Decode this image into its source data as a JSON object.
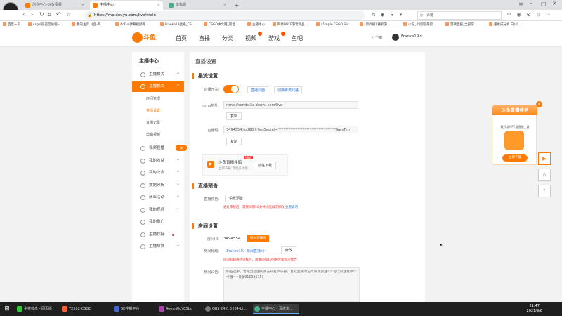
{
  "browser": {
    "tabs": [
      {
        "label": "创作中心-斗鱼视频",
        "active": false
      },
      {
        "label": "主播中心",
        "active": true
      },
      {
        "label": "无标题",
        "active": false
      }
    ],
    "new_tab": "+",
    "url": "https://mp.douyu.com/live/main",
    "search_placeholder": "百度",
    "bookmarks": [
      "百度一下",
      "csgo吧-百度贴吧--...",
      "我的主页 斗鱼-每...",
      "AcFun弹幕视频网...",
      "Franke19直播_CS...",
      "CSGO中文网_最佳...",
      "主播中心",
      "网易BUFF游戏饰品...",
      "s1mple CSGO Set...",
      "[新闻播] 赛机游...",
      "小说_小说网,最新...",
      "游戏直播_全部游...",
      "董希成分析 白(4)..."
    ]
  },
  "site": {
    "logo_text": "斗鱼",
    "nav": [
      "首页",
      "直播",
      "分类",
      "视频",
      "游戏",
      "鱼吧"
    ],
    "download": "下载",
    "username": "Franke19 ▾"
  },
  "sidebar": {
    "title": "主播中心",
    "items": [
      {
        "label": "主播相关",
        "arrow": "^"
      },
      {
        "label": "直播相关",
        "arrow": "^"
      },
      {
        "label": "视频投播",
        "arrow": "^"
      },
      {
        "label": "我的收益",
        "arrow": "^"
      },
      {
        "label": "我的公会",
        "arrow": "^"
      },
      {
        "label": "数据分析",
        "arrow": "^"
      },
      {
        "label": "商业活动",
        "arrow": "^"
      },
      {
        "label": "我的视频",
        "arrow": "^"
      },
      {
        "label": "我的推广",
        "arrow": ""
      },
      {
        "label": "主播扶持",
        "arrow": ""
      },
      {
        "label": "主播帮贷",
        "arrow": "^"
      }
    ],
    "subitems": [
      "房间管理",
      "直播设置",
      "直播记录",
      "剪辑视频"
    ],
    "hot_badge": "新"
  },
  "content": {
    "page_title": "直播设置",
    "stream": {
      "heading": "推流设置",
      "switch_label": "直播开关:",
      "link1": "直播封面",
      "link2": "切换推流线路",
      "rtmp_label": "rtmp地址:",
      "rtmp_value": "rtmp://sendtc3a.douyu.com/live",
      "copy1": "复制",
      "code_label": "直播码:",
      "code_value": "3494554rloU8BJfr?wsSecret=*********************************&wsTim",
      "copy2": "复制",
      "companion_title": "斗鱼直播伴侣",
      "companion_sub": "立即下载 享更多功能",
      "companion_new": "NEW",
      "companion_btn": "前往下载"
    },
    "notice": {
      "heading": "直播预告",
      "label": "直播预告:",
      "btn": "设置预告",
      "note": "通过审核后，需要间隔10分钟才能再次修改",
      "link": "查看说明"
    },
    "room": {
      "heading": "房间设置",
      "id_label": "房间ID:",
      "id_value": "3494554",
      "id_btn": "进入直播间",
      "title_label": "房间标题:",
      "title_value": "【Franke19】新闻直播间~",
      "title_btn": "修改",
      "title_note": "房间标题通过审核后，需要间隔10分钟才能再次修改",
      "announce_label": "房间公告:",
      "announce_value": "职业选手，曾效力过国内多支知名俱乐部，喜欢主播的记得点点关注~~可以的话再点个卡哦~~Q群915035753"
    }
  },
  "promo": {
    "title": "斗鱼直播伴侣",
    "sub": "最好用的PC端直播工具",
    "btn": "立即下载",
    "close": "×"
  },
  "taskbar": {
    "items": [
      "半夜核盘 - 网页版",
      "72502-CSGO",
      "SE控制平台",
      "4eevrWuYC5bc",
      "OBS 24.0.3 (64-bi...",
      "主播中心 - 百度浏..."
    ],
    "time": "21:47",
    "date": "2021/9/6"
  }
}
